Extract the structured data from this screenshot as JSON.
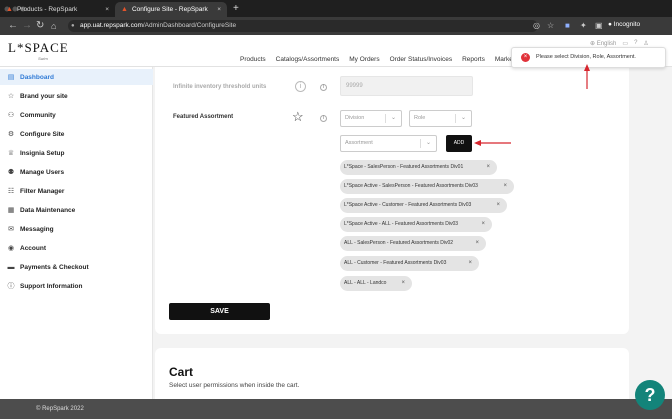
{
  "browser": {
    "tabs": [
      {
        "title": "Products - RepSpark"
      },
      {
        "title": "Configure Site - RepSpark"
      }
    ],
    "url_host": "app.uat.repspark.com",
    "url_path": "/AdminDashboard/ConfigureSite",
    "profile_label": "Incognito"
  },
  "header": {
    "logo": "L*SPACE",
    "logo_sub": "Swim",
    "nav": [
      "Products",
      "Catalogs/Assortments",
      "My Orders",
      "Order Status/Invoices",
      "Reports",
      "Marke"
    ],
    "language": "English"
  },
  "sidebar": {
    "items": [
      {
        "label": "Dashboard",
        "icon": "dashboard-icon"
      },
      {
        "label": "Brand your site",
        "icon": "star-icon"
      },
      {
        "label": "Community",
        "icon": "users-icon"
      },
      {
        "label": "Configure Site",
        "icon": "gear-icon"
      },
      {
        "label": "Insignia Setup",
        "icon": "insignia-icon"
      },
      {
        "label": "Manage Users",
        "icon": "user-manage-icon"
      },
      {
        "label": "Filter Manager",
        "icon": "filter-icon"
      },
      {
        "label": "Data Maintenance",
        "icon": "database-icon"
      },
      {
        "label": "Messaging",
        "icon": "mail-icon"
      },
      {
        "label": "Account",
        "icon": "account-icon"
      },
      {
        "label": "Payments & Checkout",
        "icon": "card-icon"
      },
      {
        "label": "Support Information",
        "icon": "info-icon"
      }
    ]
  },
  "form": {
    "threshold_label": "Infinite inventory threshold units",
    "threshold_value": "99999",
    "featured_label": "Featured Assortment",
    "division_placeholder": "Division",
    "role_placeholder": "Role",
    "assortment_placeholder": "Assortment",
    "add_label": "ADD",
    "chips": [
      "L*Space - SalesPerson - Featured Assortments Div01",
      "L*Space Active - SalesPerson - Featured Assortments Div03",
      "L*Space Active - Customer - Featured Assortments Div03",
      "L*Space Active - ALL - Featured Assortments Div03",
      "ALL - SalesPerson - Featured Assortments Div02",
      "ALL - Customer - Featured Assortments Div03",
      "ALL - ALL - Landco"
    ],
    "save_label": "SAVE"
  },
  "cart": {
    "title": "Cart",
    "subtitle": "Select user permissions when inside the cart."
  },
  "toast": {
    "message": "Please select Division, Role, Assortment."
  },
  "footer": {
    "copyright": "© RepSpark 2022"
  },
  "colors": {
    "accent": "#2f7ad6",
    "error": "#e0323a",
    "arrow": "#d6262e",
    "help": "#13847a"
  }
}
